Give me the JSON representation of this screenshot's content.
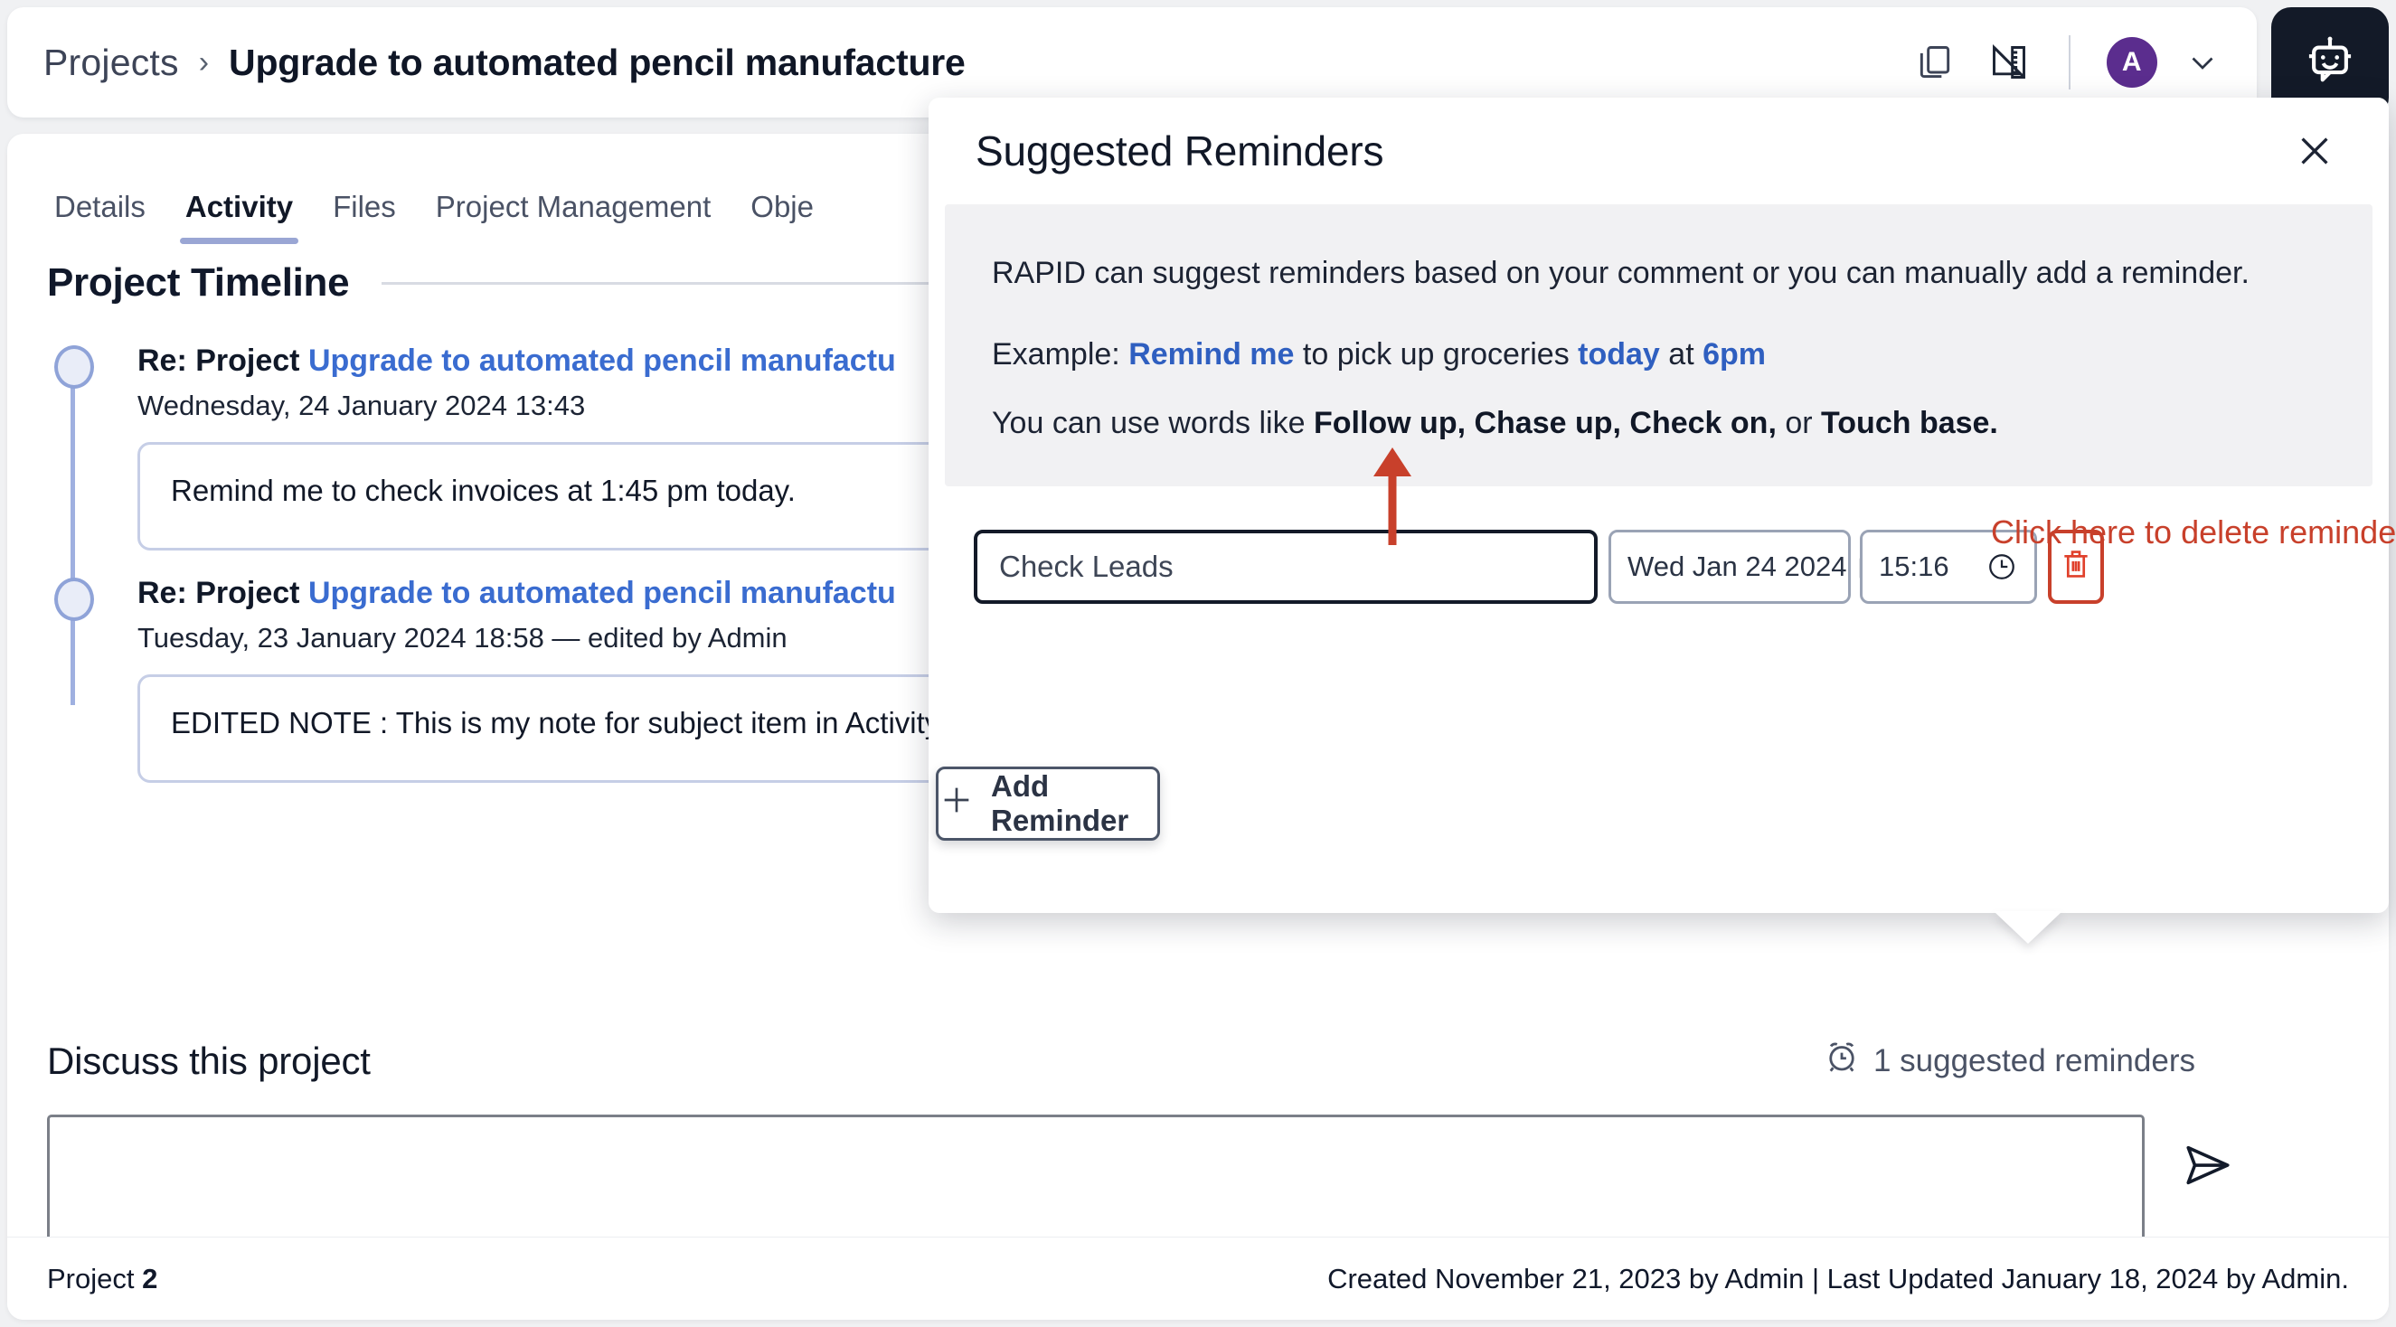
{
  "header": {
    "breadcrumb_root": "Projects",
    "breadcrumb_sep": "›",
    "breadcrumb_current": "Upgrade to automated pencil manufacture",
    "copy_icon": "copy-documents-icon",
    "ruler_icon": "ruler-triangle-icon",
    "avatar_initial": "A",
    "chevron_icon": "chevron-down-icon",
    "bot_icon": "robot-assistant-icon",
    "avatar_color": "#5b2d8e",
    "bot_bg": "#131a28"
  },
  "tabs": [
    {
      "label": "Details",
      "active": false
    },
    {
      "label": "Activity",
      "active": true
    },
    {
      "label": "Files",
      "active": false
    },
    {
      "label": "Project Management",
      "active": false
    },
    {
      "label": "Obje",
      "active": false
    }
  ],
  "timeline": {
    "title": "Project Timeline",
    "items": [
      {
        "subject_prefix": "Re: Project ",
        "subject_link": "Upgrade to automated pencil manufactu",
        "date": "Wednesday, 24 January 2024 13:43",
        "note": "Remind me to check invoices at 1:45 pm today."
      },
      {
        "subject_prefix": "Re: Project ",
        "subject_link": "Upgrade to automated pencil manufactu",
        "date": "Tuesday, 23 January 2024 18:58 — edited by Admin",
        "note": "EDITED NOTE : This is my note for subject item in Activity FEED"
      }
    ]
  },
  "discuss": {
    "title": "Discuss this project",
    "suggested_count_label": "1 suggested reminders",
    "alarm_icon": "alarm-clock-icon",
    "comment_value": "",
    "comment_placeholder": "",
    "send_icon": "send-paper-plane-icon"
  },
  "footer": {
    "project_label": "Project ",
    "project_number": "2",
    "meta": "Created November 21, 2023 by Admin | Last Updated January 18, 2024 by Admin."
  },
  "popup": {
    "title": "Suggested Reminders",
    "close_icon": "close-x-icon",
    "info_line1": "RAPID can suggest reminders based on your comment or you can manually add a reminder.",
    "example_prefix": "Example: ",
    "example_b1": "Remind me",
    "example_mid1": " to pick up groceries ",
    "example_b2": "today",
    "example_mid2": " at ",
    "example_b3": "6pm",
    "words_prefix": "You can use words like ",
    "words_b1": "Follow up, Chase up, Check on,",
    "words_mid": " or ",
    "words_b2": "Touch base.",
    "reminder": {
      "name_value": "Check Leads",
      "date_value": "Wed Jan 24 2024",
      "time_value": "15:16",
      "calendar_icon": "calendar-icon",
      "clock_icon": "clock-icon",
      "delete_icon": "trash-delete-icon"
    },
    "annotation": "Click here to delete reminder",
    "annotation_color": "#c8402b",
    "add_reminder_label": "Add Reminder",
    "plus_icon": "plus-icon"
  }
}
